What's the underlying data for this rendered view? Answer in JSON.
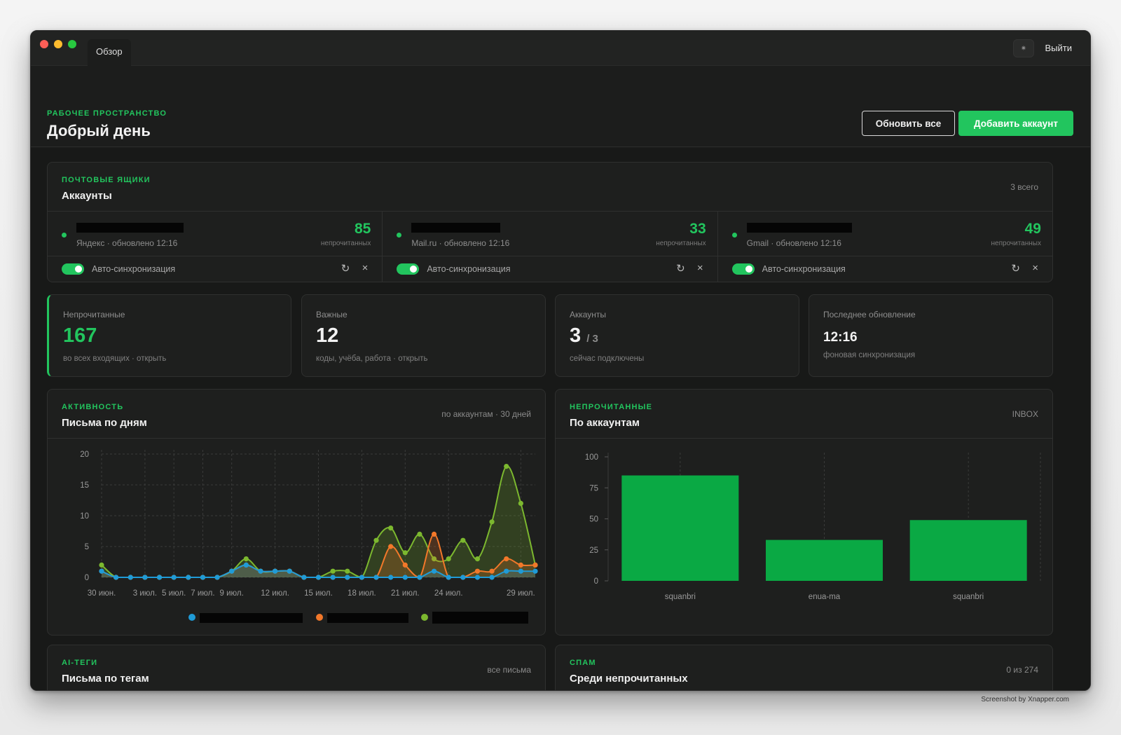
{
  "window": {
    "tab": "Обзор",
    "logout": "Выйти"
  },
  "header": {
    "eyebrow": "РАБОЧЕЕ ПРОСТРАНСТВО",
    "title": "Добрый день",
    "refresh_all": "Обновить все",
    "add_account": "Добавить аккаунт"
  },
  "mailboxes": {
    "eyebrow": "ПОЧТОВЫЕ ЯЩИКИ",
    "title": "Аккаунты",
    "meta": "3 всего",
    "unread_label": "непрочитанных",
    "autosync_label": "Авто-синхронизация",
    "accounts": [
      {
        "provider": "Яндекс · обновлено 12:16",
        "unread": "85",
        "autosync": true
      },
      {
        "provider": "Mail.ru · обновлено 12:16",
        "unread": "33",
        "autosync": true
      },
      {
        "provider": "Gmail · обновлено 12:16",
        "unread": "49",
        "autosync": true
      }
    ]
  },
  "stats": [
    {
      "label": "Непрочитанные",
      "value": "167",
      "sub": "во всех входящих · открыть"
    },
    {
      "label": "Важные",
      "value": "12",
      "sub": "коды, учёба, работа · открыть"
    },
    {
      "label": "Аккаунты",
      "value": "3",
      "of": "/ 3",
      "sub": "сейчас подключены"
    },
    {
      "label": "Последнее обновление",
      "value": "12:16",
      "sub": "фоновая синхронизация"
    }
  ],
  "activity": {
    "eyebrow": "АКТИВНОСТЬ",
    "title": "Письма по дням",
    "meta": "по аккаунтам · 30 дней"
  },
  "unread_by_account": {
    "eyebrow": "НЕПРОЧИТАННЫЕ",
    "title": "По аккаунтам",
    "meta": "INBOX"
  },
  "ai_tags": {
    "eyebrow": "AI-ТЕГИ",
    "title": "Письма по тегам",
    "meta": "все письма"
  },
  "spam": {
    "eyebrow": "СПАМ",
    "title": "Среди непрочитанных",
    "meta": "0 из 274"
  },
  "credit": "Screenshot by Xnapper.com",
  "colors": {
    "accent": "#22c55e",
    "series_blue": "#1f9bd7",
    "series_orange": "#f2782a",
    "series_green": "#7cb82f",
    "bar": "#0aa944"
  },
  "chart_data": [
    {
      "type": "line",
      "x": [
        "30 июн.",
        "1 июл.",
        "2 июл.",
        "3 июл.",
        "4 июл.",
        "5 июл.",
        "6 июл.",
        "7 июл.",
        "8 июл.",
        "9 июл.",
        "10 июл.",
        "11 июл.",
        "12 июл.",
        "13 июл.",
        "14 июл.",
        "15 июл.",
        "16 июл.",
        "17 июл.",
        "18 июл.",
        "19 июл.",
        "20 июл.",
        "21 июл.",
        "22 июл.",
        "23 июл.",
        "24 июл.",
        "25 июл.",
        "26 июл.",
        "27 июл.",
        "28 июл.",
        "29 июл.",
        "30 июл."
      ],
      "tick_labels": [
        "30 июн.",
        "3 июл.",
        "5 июл.",
        "7 июл.",
        "9 июл.",
        "12 июл.",
        "15 июл.",
        "18 июл.",
        "21 июл.",
        "24 июл.",
        "29 июл."
      ],
      "ylim": [
        0,
        20
      ],
      "yticks": [
        0,
        5,
        10,
        15,
        20
      ],
      "grid": true,
      "series": [
        {
          "color": "#1f9bd7",
          "values": [
            1,
            0,
            0,
            0,
            0,
            0,
            0,
            0,
            0,
            1,
            2,
            1,
            1,
            1,
            0,
            0,
            0,
            0,
            0,
            0,
            0,
            0,
            0,
            1,
            0,
            0,
            0,
            0,
            1,
            1,
            1
          ]
        },
        {
          "color": "#f2782a",
          "values": [
            1,
            0,
            0,
            0,
            0,
            0,
            0,
            0,
            0,
            1,
            2,
            1,
            1,
            1,
            0,
            0,
            0,
            0,
            0,
            0,
            5,
            2,
            0,
            7,
            0,
            0,
            1,
            1,
            3,
            2,
            2
          ]
        },
        {
          "color": "#7cb82f",
          "values": [
            2,
            0,
            0,
            0,
            0,
            0,
            0,
            0,
            0,
            1,
            3,
            1,
            1,
            1,
            0,
            0,
            1,
            1,
            0,
            6,
            8,
            4,
            7,
            3,
            3,
            6,
            3,
            9,
            18,
            12,
            2
          ]
        }
      ]
    },
    {
      "type": "bar",
      "categories": [
        "squanbri",
        "enua-ma",
        "squanbri"
      ],
      "values": [
        85,
        33,
        49
      ],
      "ylim": [
        0,
        100
      ],
      "yticks": [
        0,
        25,
        50,
        75,
        100
      ]
    }
  ]
}
